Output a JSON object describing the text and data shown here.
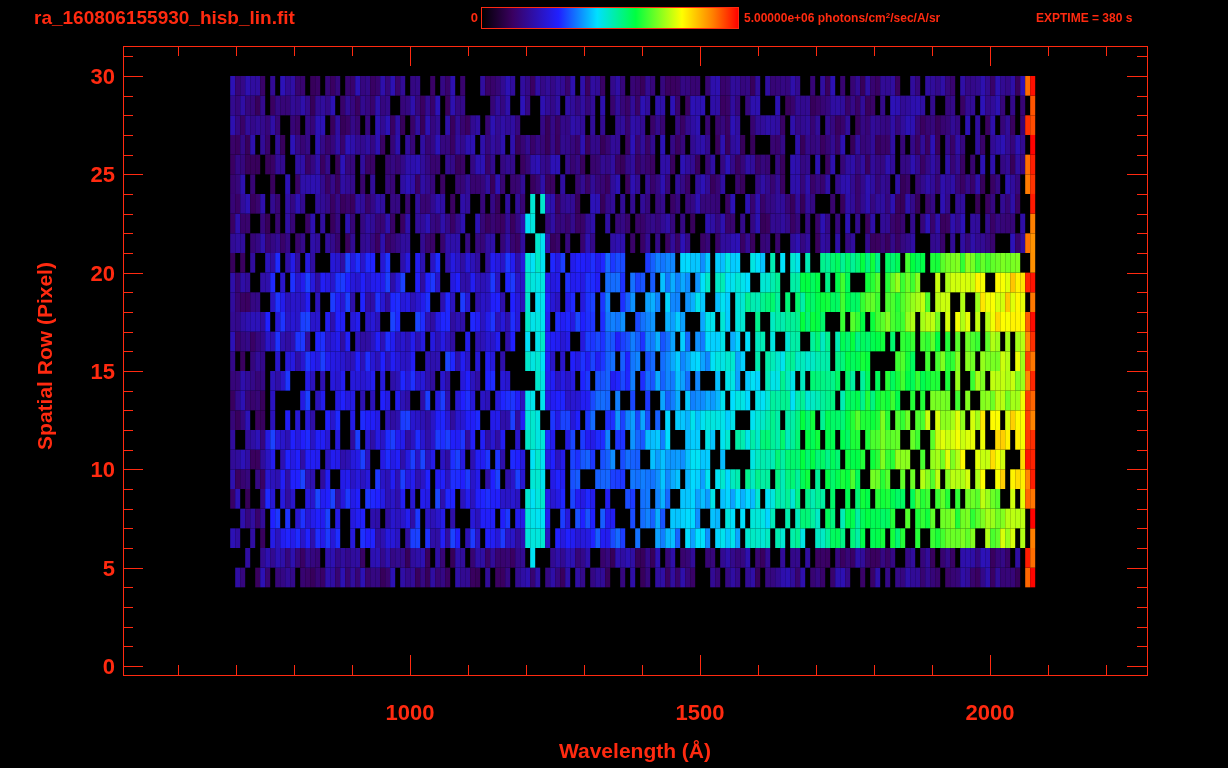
{
  "title": "ra_160806155930_hisb_lin.fit",
  "colorbar": {
    "min_label": "0",
    "max_label": "5.00000e+06 photons/cm$^{2}$/sec/A/sr"
  },
  "exposure": "EXPTIME = 380 s",
  "plot": {
    "xlabel": "Wavelength (Å)",
    "ylabel": "Spatial Row (Pixel)",
    "xticks": [
      "1000",
      "1500",
      "2000"
    ],
    "yticks": [
      "30",
      "25",
      "20",
      "15",
      "10",
      "5",
      "0"
    ]
  }
}
